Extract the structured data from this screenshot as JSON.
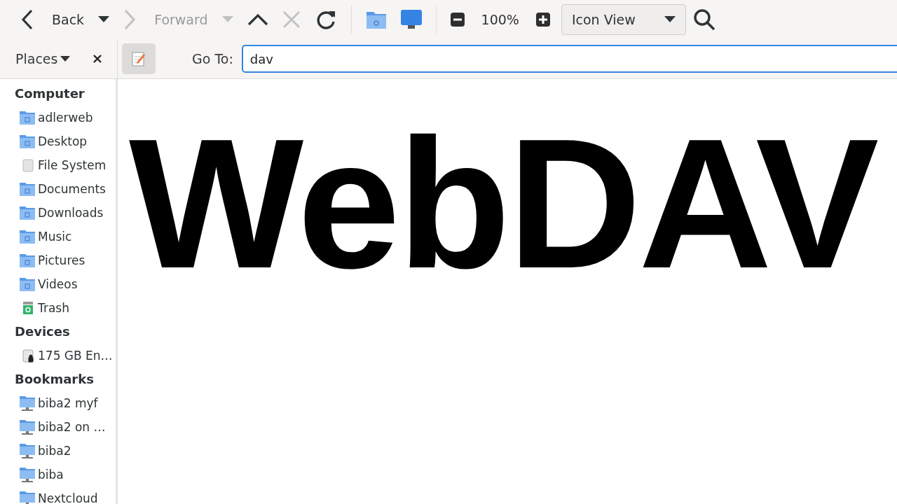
{
  "toolbar": {
    "items": [
      {
        "kind": "back",
        "label": "Back",
        "disabled": false
      },
      {
        "kind": "menu",
        "disabled": false
      },
      {
        "kind": "forward",
        "label": "Forward",
        "disabled": true
      },
      {
        "kind": "menu",
        "disabled": true
      },
      {
        "kind": "up",
        "disabled": false
      },
      {
        "kind": "stop",
        "disabled": true
      },
      {
        "kind": "reload",
        "disabled": false
      },
      {
        "kind": "separator"
      },
      {
        "kind": "home",
        "disabled": false
      },
      {
        "kind": "computer",
        "disabled": false
      },
      {
        "kind": "separator"
      },
      {
        "kind": "zoom-out",
        "disabled": false
      },
      {
        "kind": "zoom-level",
        "label": "100%"
      },
      {
        "kind": "zoom-in",
        "disabled": false
      },
      {
        "kind": "view",
        "label": "Icon View"
      },
      {
        "kind": "search",
        "disabled": false
      }
    ]
  },
  "location_bar": {
    "pane_selector": "Places",
    "edit_toggle": {
      "pressed": true
    },
    "label": "Go To:",
    "value": "dav"
  },
  "sidebar": {
    "sections": [
      {
        "title": "Computer",
        "items": [
          {
            "kind": "folder",
            "label": "adlerweb"
          },
          {
            "kind": "folder",
            "label": "Desktop"
          },
          {
            "kind": "drive",
            "label": "File System"
          },
          {
            "kind": "folder",
            "label": "Documents"
          },
          {
            "kind": "folder",
            "label": "Downloads"
          },
          {
            "kind": "folder",
            "label": "Music"
          },
          {
            "kind": "folder",
            "label": "Pictures"
          },
          {
            "kind": "folder",
            "label": "Videos"
          },
          {
            "kind": "trash",
            "label": "Trash"
          }
        ]
      },
      {
        "title": "Devices",
        "items": [
          {
            "kind": "disk",
            "label": "175 GB En…"
          }
        ]
      },
      {
        "title": "Bookmarks",
        "items": [
          {
            "kind": "network",
            "label": "biba2 myf"
          },
          {
            "kind": "network",
            "label": "biba2 on …"
          },
          {
            "kind": "network",
            "label": "biba2"
          },
          {
            "kind": "network",
            "label": "biba"
          },
          {
            "kind": "network",
            "label": "Nextcloud"
          }
        ]
      }
    ]
  },
  "content": {
    "title": "WebDAV"
  }
}
